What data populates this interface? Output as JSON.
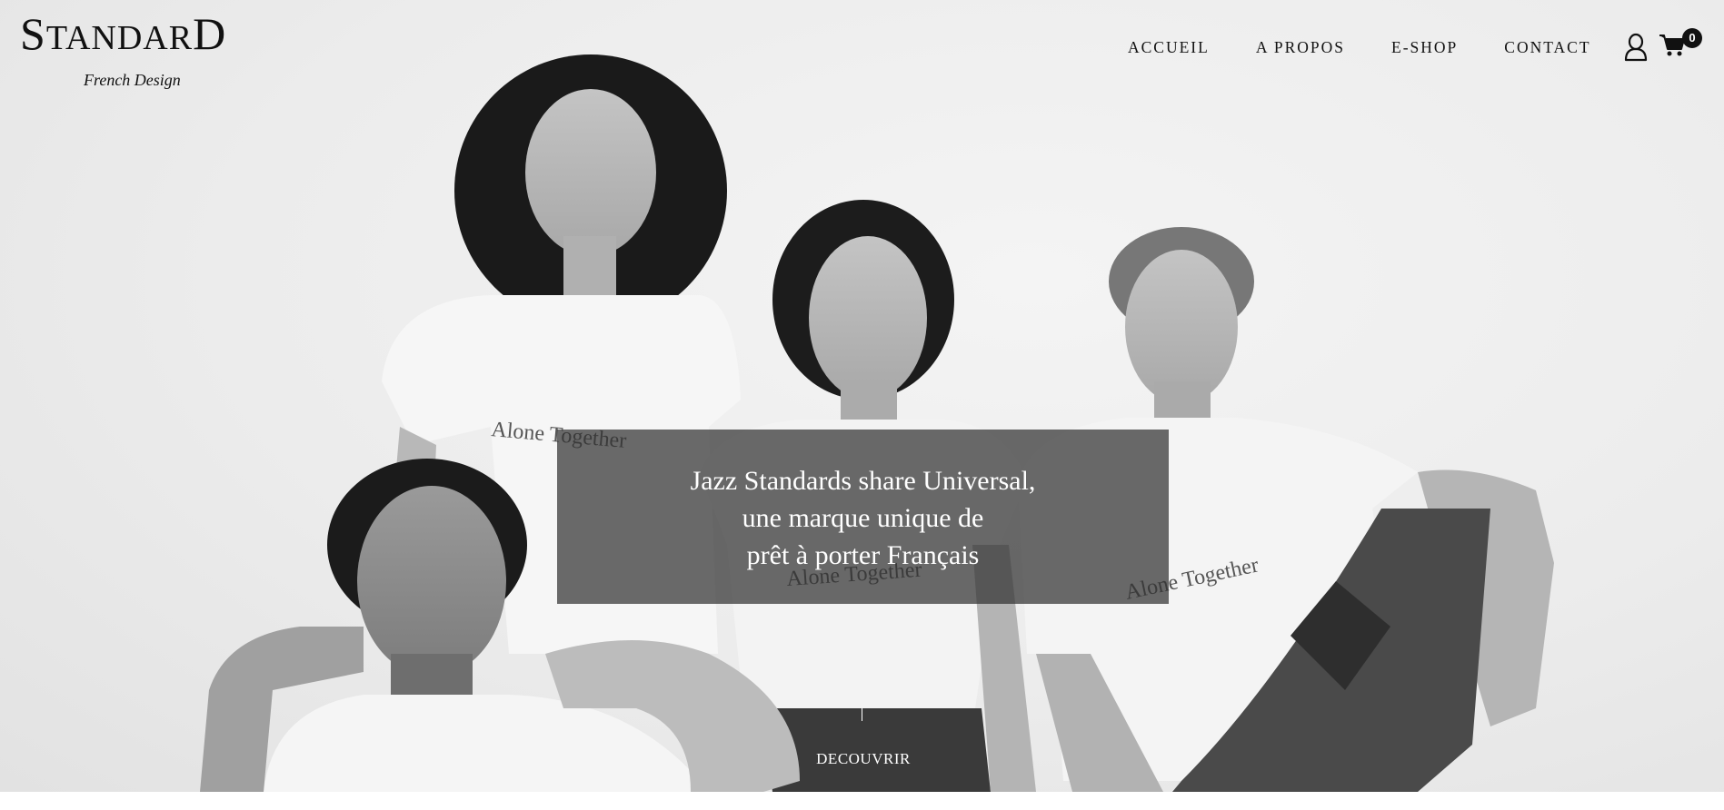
{
  "brand": {
    "name_first": "S",
    "name_rest": "TANDAR",
    "name_last": "D",
    "tagline": "French Design"
  },
  "nav": {
    "items": [
      {
        "label": "ACCUEIL"
      },
      {
        "label": "A PROPOS"
      },
      {
        "label": "E-SHOP"
      },
      {
        "label": "CONTACT"
      }
    ],
    "account_icon": "user-icon",
    "cart_icon": "shopping-cart-icon",
    "cart_count": "0"
  },
  "hero": {
    "headline_lines": [
      "Jazz Standards share Universal,",
      "une marque unique de",
      "prêt à porter Français"
    ],
    "cta_label": "DECOUVRIR",
    "shirt_print": "Alone Together",
    "overlay_color": "#333333"
  }
}
